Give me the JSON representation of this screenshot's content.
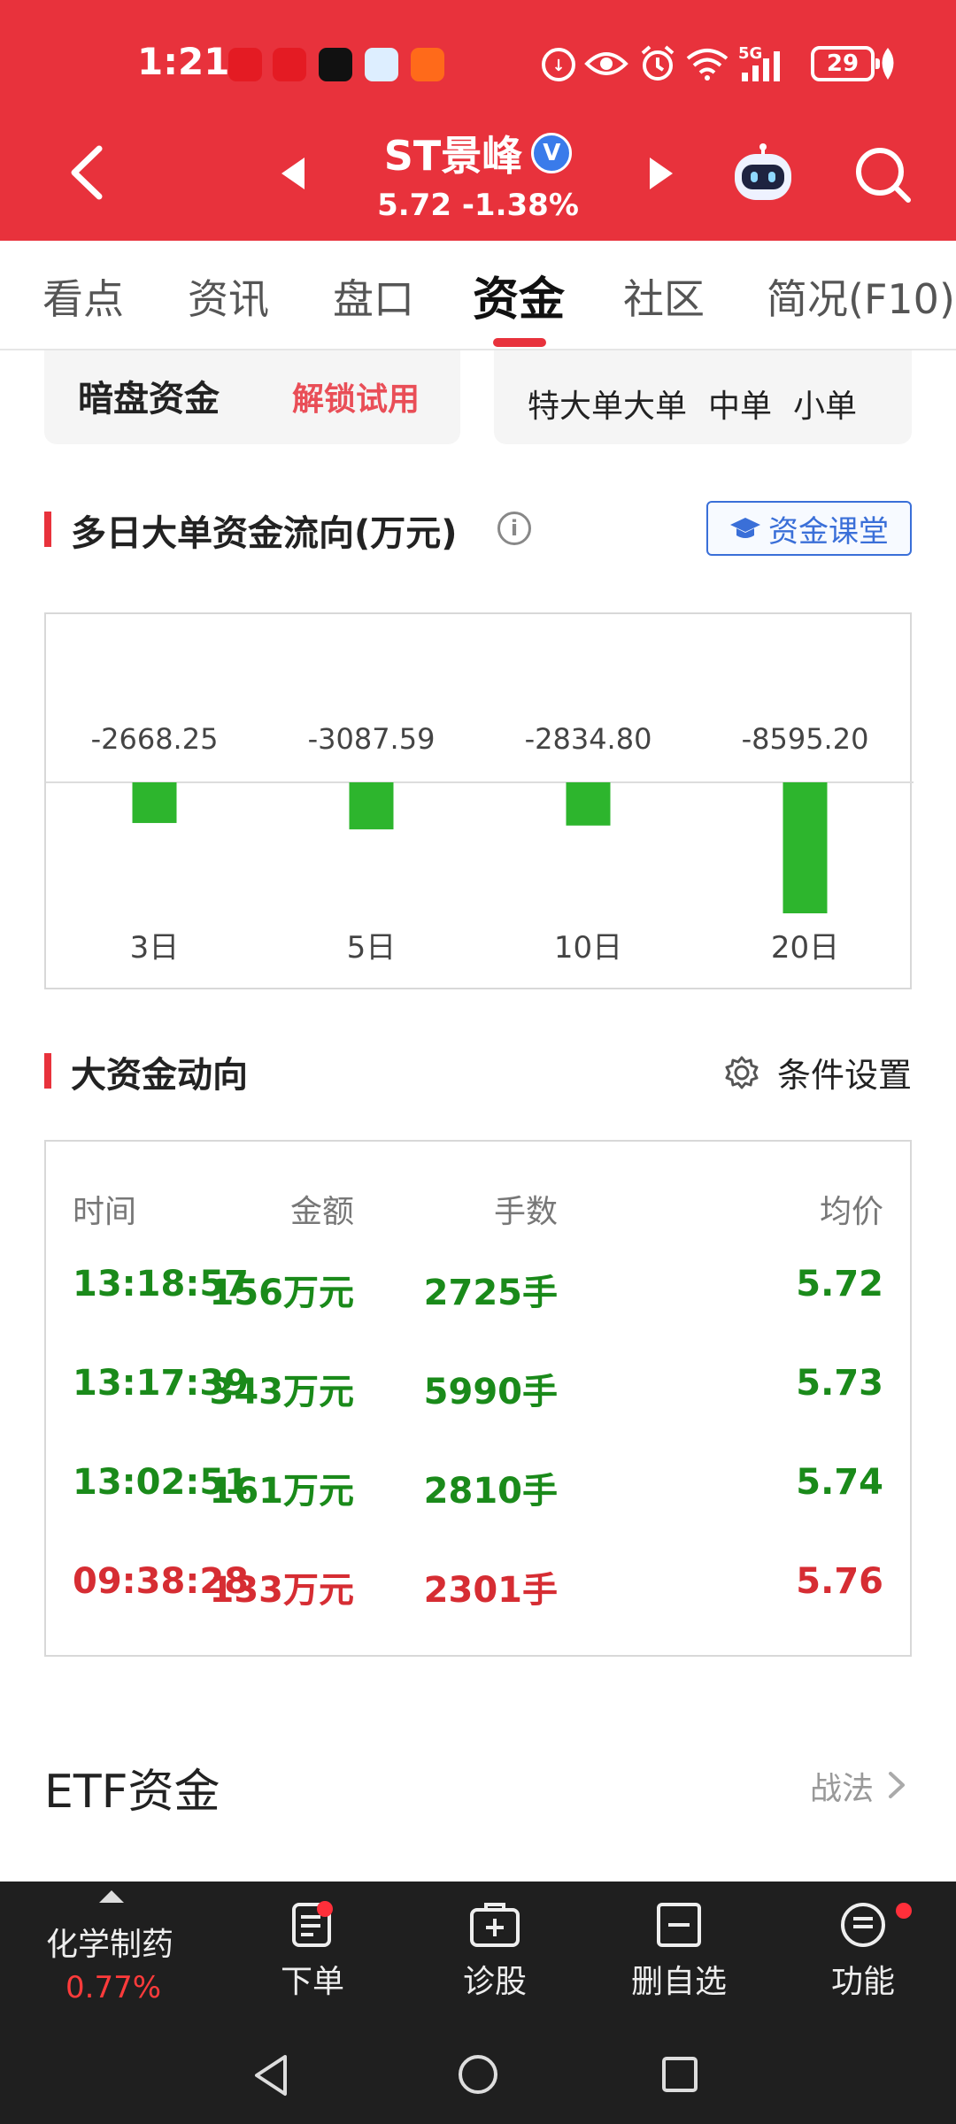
{
  "status_bar": {
    "time": "1:21",
    "network": "5G",
    "battery": "29"
  },
  "header": {
    "stock_name": "ST景峰",
    "verified_badge": "V",
    "price_line": "5.72  -1.38%"
  },
  "tabs": [
    {
      "label": "看点"
    },
    {
      "label": "资讯"
    },
    {
      "label": "盘口"
    },
    {
      "label": "资金"
    },
    {
      "label": "社区"
    },
    {
      "label": "简况(F10)"
    }
  ],
  "cards": {
    "left_title": "暗盘资金",
    "left_action": "解锁试用",
    "right_labels": [
      "特大单",
      "大单",
      "中单",
      "小单"
    ]
  },
  "multi_day": {
    "title": "多日大单资金流向(万元)",
    "class_button": "资金课堂"
  },
  "chart_data": {
    "type": "bar",
    "categories": [
      "3日",
      "5日",
      "10日",
      "20日"
    ],
    "values": [
      -2668.25,
      -3087.59,
      -2834.8,
      -8595.2
    ],
    "value_labels": [
      "-2668.25",
      "-3087.59",
      "-2834.80",
      "-8595.20"
    ],
    "colors": {
      "negative": "#2db52d",
      "positive": "#e8323c"
    }
  },
  "big_funds": {
    "title": "大资金动向",
    "settings_label": "条件设置",
    "headers": [
      "时间",
      "金额",
      "手数",
      "均价"
    ],
    "rows": [
      {
        "time": "13:18:57",
        "amount": "156万元",
        "lots": "2725手",
        "avg": "5.72",
        "dir": "green"
      },
      {
        "time": "13:17:39",
        "amount": "343万元",
        "lots": "5990手",
        "avg": "5.73",
        "dir": "green"
      },
      {
        "time": "13:02:51",
        "amount": "161万元",
        "lots": "2810手",
        "avg": "5.74",
        "dir": "green"
      },
      {
        "time": "09:38:28",
        "amount": "133万元",
        "lots": "2301手",
        "avg": "5.76",
        "dir": "red"
      }
    ]
  },
  "etf": {
    "title": "ETF资金",
    "link": "战法"
  },
  "bottom_bar": {
    "sector_name": "化学制药",
    "sector_change": "0.77%",
    "items": [
      {
        "label": "下单",
        "icon": "order-icon"
      },
      {
        "label": "诊股",
        "icon": "diagnose-icon"
      },
      {
        "label": "删自选",
        "icon": "remove-watchlist-icon"
      },
      {
        "label": "功能",
        "icon": "menu-icon"
      }
    ]
  },
  "theme": {
    "brand_red": "#e8323c",
    "up_red": "#d62d33",
    "down_green": "#1a8a1a"
  }
}
